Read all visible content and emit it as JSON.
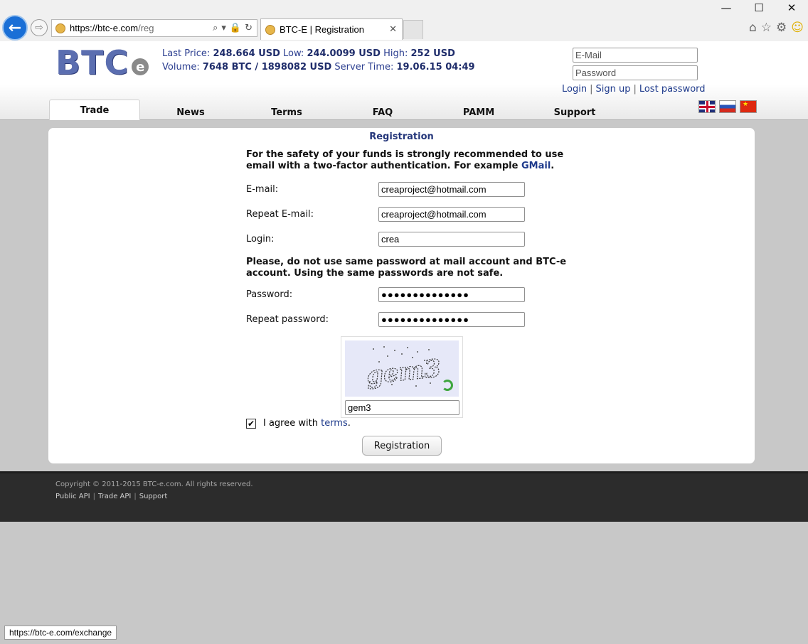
{
  "browser": {
    "url_host": "https://btc-e.com",
    "url_path": "/reg",
    "tab_title": "BTC-E | Registration",
    "status_url": "https://btc-e.com/exchange",
    "win_minimize": "—",
    "win_maximize": "☐",
    "win_close": "✕",
    "back_glyph": "←",
    "forward_glyph": "⇨",
    "search_glyph": "⌕",
    "dropdown_glyph": "▾",
    "lock_glyph": "🔒",
    "refresh_glyph": "↻",
    "tab_close_glyph": "✕",
    "home_glyph": "⌂",
    "favorites_glyph": "☆",
    "settings_glyph": "⚙",
    "smiley_glyph": "☺"
  },
  "header": {
    "logo_text": "BTC",
    "logo_e": "e",
    "ticker": {
      "last_price_label": "Last Price:",
      "last_price": "248.664 USD",
      "low_label": "Low:",
      "low": "244.0099 USD",
      "high_label": "High:",
      "high": "252 USD",
      "volume_label": "Volume:",
      "volume": "7648 BTC / 1898082 USD",
      "server_time_label": "Server Time:",
      "server_time": "19.06.15 04:49"
    },
    "login": {
      "email_placeholder": "E-Mail",
      "password_placeholder": "Password",
      "login_link": "Login",
      "signup_link": "Sign up",
      "lost_password_link": "Lost password",
      "separator": "|"
    },
    "nav": [
      "Trade",
      "News",
      "Terms",
      "FAQ",
      "PAMM",
      "Support"
    ]
  },
  "registration": {
    "title": "Registration",
    "notice_safety": "For the safety of your funds is strongly recommended to use email with a two-factor authentication. For example ",
    "notice_gmail": "GMail",
    "notice_end": ".",
    "email_label": "E-mail:",
    "email_value": "creaproject@hotmail.com",
    "repeat_email_label": "Repeat E-mail:",
    "repeat_email_value": "creaproject@hotmail.com",
    "login_label": "Login:",
    "login_value": "crea",
    "notice_password": "Please, do not use same password at mail account and BTC-e account. Using the same passwords are not safe.",
    "password_label": "Password:",
    "password_value": "●●●●●●●●●●●●●●",
    "repeat_password_label": "Repeat password:",
    "repeat_password_value": "●●●●●●●●●●●●●●",
    "captcha_text": "gem3",
    "captcha_value": "gem3",
    "agree_text": "I agree with ",
    "terms_link": "terms",
    "agree_end": ".",
    "agree_checked": "✔",
    "submit_label": "Registration"
  },
  "footer": {
    "copyright": "Copyright © 2011-2015 BTC-e.com. All rights reserved.",
    "links": [
      "Public API",
      "Trade API",
      "Support"
    ],
    "separator": "|"
  },
  "colors": {
    "link": "#1f3b8c",
    "ticker": "#2a3d8f",
    "logo": "#5b6eb0",
    "page_bg": "#c8c8c8",
    "footer_bg": "#2c2c2c"
  }
}
